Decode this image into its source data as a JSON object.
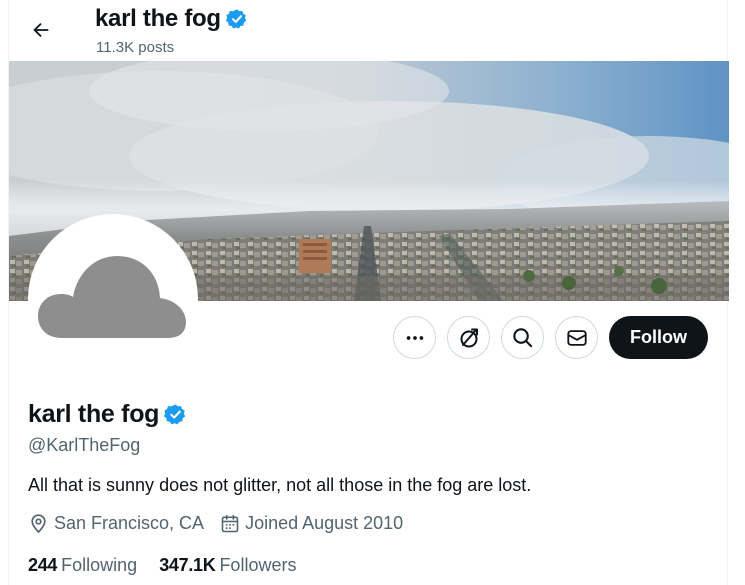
{
  "header": {
    "title": "karl the fog",
    "posts": "11.3K posts"
  },
  "profile": {
    "name": "karl the fog",
    "handle": "@KarlTheFog",
    "bio": "All that is sunny does not glitter, not all those in the fog are lost.",
    "location": "San Francisco, CA",
    "joined": "Joined August 2010",
    "following_count": "244",
    "following_label": "Following",
    "followers_count": "347.1K",
    "followers_label": "Followers",
    "verified": true
  },
  "actions": {
    "follow_label": "Follow",
    "icons": [
      "more-icon",
      "subscribe-icon",
      "search-icon",
      "message-icon"
    ]
  },
  "colors": {
    "verified_blue": "#1d9bf0",
    "text_primary": "#0f1419",
    "text_secondary": "#536471",
    "follow_bg": "#0f1419"
  }
}
